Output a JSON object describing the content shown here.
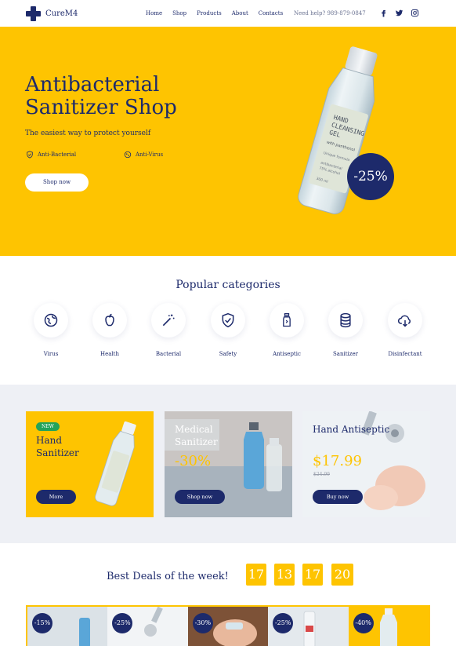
{
  "header": {
    "logo_text": "CureM4",
    "menu": [
      "Home",
      "Shop",
      "Products",
      "About",
      "Contacts"
    ],
    "help_text": "Need help? 989-879-0847",
    "social_icons": [
      "facebook-icon",
      "twitter-icon",
      "instagram-icon"
    ]
  },
  "hero": {
    "title_line1": "Antibacterial",
    "title_line2": "Sanitizer Shop",
    "subtitle": "The easiest way to protect yourself",
    "feature1": "Anti-Bacterial",
    "feature2": "Anti-Virus",
    "button": "Shop now",
    "discount": "-25%",
    "bottle_label": [
      "HAND",
      "CLEANSING",
      "GEL",
      "with panthenol",
      "Unique formula",
      "antibacterial",
      "75% alcohol"
    ],
    "bottle_volume": "300 ml"
  },
  "categories": {
    "title": "Popular categories",
    "items": [
      {
        "label": "Virus",
        "icon": "virus-icon"
      },
      {
        "label": "Health",
        "icon": "apple-icon"
      },
      {
        "label": "Bacterial",
        "icon": "magic-wand-icon"
      },
      {
        "label": "Safety",
        "icon": "shield-icon"
      },
      {
        "label": "Antiseptic",
        "icon": "bottle-icon"
      },
      {
        "label": "Sanitizer",
        "icon": "database-icon"
      },
      {
        "label": "Disinfectant",
        "icon": "cloud-download-icon"
      }
    ]
  },
  "promos": [
    {
      "badge": "NEW",
      "title": "Hand Sanitizer",
      "button": "More"
    },
    {
      "title": "Medical Sanitizer",
      "price": "-30%",
      "button": "Shop now"
    },
    {
      "title": "Hand Antiseptic",
      "price": "$17.99",
      "old_price": "$24.99",
      "button": "Buy now"
    }
  ],
  "deals": {
    "title": "Best Deals of the week!",
    "timer": [
      "17",
      "13",
      "17",
      "20"
    ],
    "items": [
      {
        "discount": "-15%"
      },
      {
        "discount": "-25%"
      },
      {
        "discount": "-30%"
      },
      {
        "discount": "-25%"
      },
      {
        "discount": "-40%"
      }
    ]
  },
  "colors": {
    "brand_navy": "#1d2a6b",
    "brand_yellow": "#fec401",
    "new_badge": "#22a35a",
    "band_gray": "#eef0f5"
  }
}
